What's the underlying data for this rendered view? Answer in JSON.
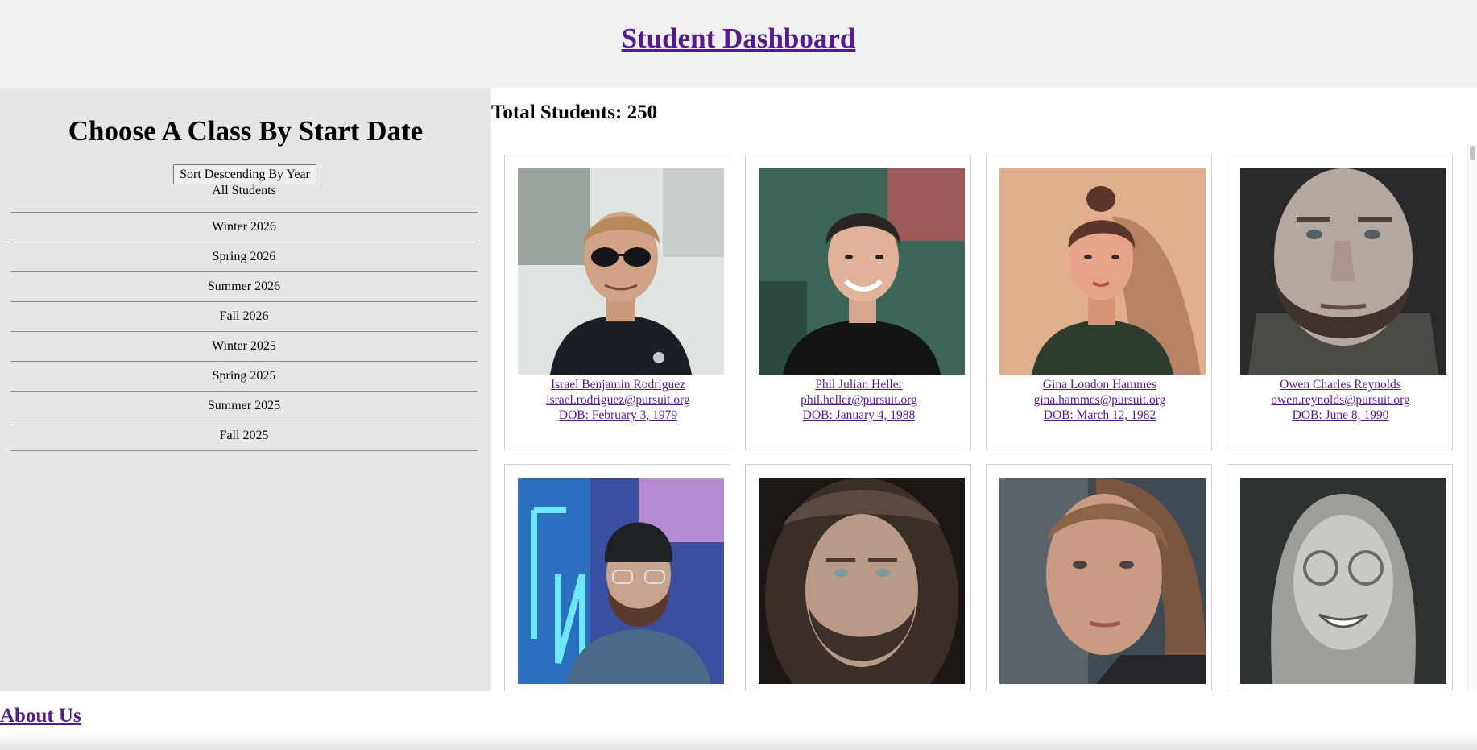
{
  "header": {
    "title": "Student Dashboard"
  },
  "sidebar": {
    "title": "Choose A Class By Start Date",
    "sort_button": "Sort Descending By Year",
    "classes": [
      "All Students",
      "Winter 2026",
      "Spring 2026",
      "Summer 2026",
      "Fall 2026",
      "Winter 2025",
      "Spring 2025",
      "Summer 2025",
      "Fall 2025"
    ]
  },
  "main": {
    "total": "Total Students: 250",
    "students": [
      {
        "name": "Israel Benjamin Rodriguez",
        "email": "israel.rodriguez@pursuit.org",
        "dob": "DOB: February 3, 1979",
        "photo_icon": "portrait-sunglasses"
      },
      {
        "name": "Phil Julian Heller",
        "email": "phil.heller@pursuit.org",
        "dob": "DOB: January 4, 1988",
        "photo_icon": "portrait-smiling-man"
      },
      {
        "name": "Gina London Hammes",
        "email": "gina.hammes@pursuit.org",
        "dob": "DOB: March 12, 1982",
        "photo_icon": "portrait-woman-bun"
      },
      {
        "name": "Owen Charles Reynolds",
        "email": "owen.reynolds@pursuit.org",
        "dob": "DOB: June 8, 1990",
        "photo_icon": "portrait-bearded-man"
      },
      {
        "name": "",
        "email": "",
        "dob": "",
        "photo_icon": "portrait-beanie-neon"
      },
      {
        "name": "",
        "email": "",
        "dob": "",
        "photo_icon": "portrait-hooded-man"
      },
      {
        "name": "",
        "email": "",
        "dob": "",
        "photo_icon": "portrait-freckled-woman"
      },
      {
        "name": "",
        "email": "",
        "dob": "",
        "photo_icon": "portrait-woman-glasses"
      }
    ]
  },
  "footer": {
    "about": "About Us"
  },
  "colors": {
    "link": "#551a8b",
    "header_bg": "#f0f0f0",
    "sidebar_bg": "#e6e6e6"
  }
}
